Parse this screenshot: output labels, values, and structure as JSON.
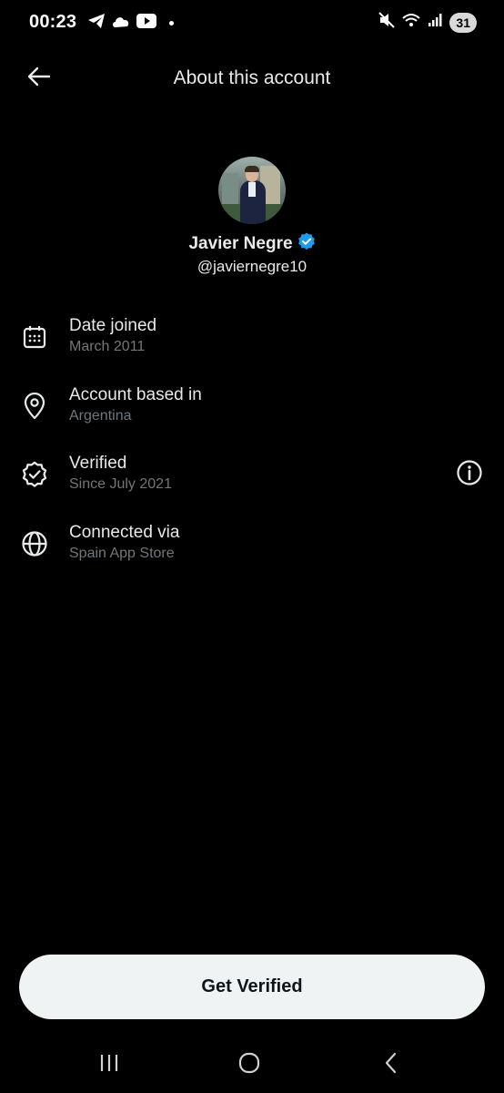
{
  "status_bar": {
    "time": "00:23",
    "battery": "31",
    "left_icons": [
      "telegram-icon",
      "cloud-icon",
      "youtube-icon"
    ],
    "right_icons": [
      "mute-icon",
      "wifi-icon",
      "signal-icon"
    ]
  },
  "header": {
    "title": "About this account",
    "back_icon": "arrow-left-icon"
  },
  "profile": {
    "display_name": "Javier Negre",
    "handle": "@javiernegre10",
    "verified_badge_color": "#1d9bf0"
  },
  "info_items": [
    {
      "icon": "calendar-icon",
      "title": "Date joined",
      "subtitle": "March 2011"
    },
    {
      "icon": "location-pin-icon",
      "title": "Account based in",
      "subtitle": "Argentina"
    },
    {
      "icon": "verified-badge-icon",
      "title": "Verified",
      "subtitle": "Since July 2021",
      "action_icon": "info-icon"
    },
    {
      "icon": "globe-icon",
      "title": "Connected via",
      "subtitle": "Spain App Store"
    }
  ],
  "cta": {
    "label": "Get Verified"
  },
  "nav_bar": {
    "items": [
      "recent-apps-icon",
      "home-icon",
      "back-icon"
    ]
  },
  "colors": {
    "background": "#000000",
    "text_primary": "#e7e9ea",
    "text_secondary": "#71767b",
    "button_bg": "#eff3f4",
    "button_text": "#0f1419"
  }
}
